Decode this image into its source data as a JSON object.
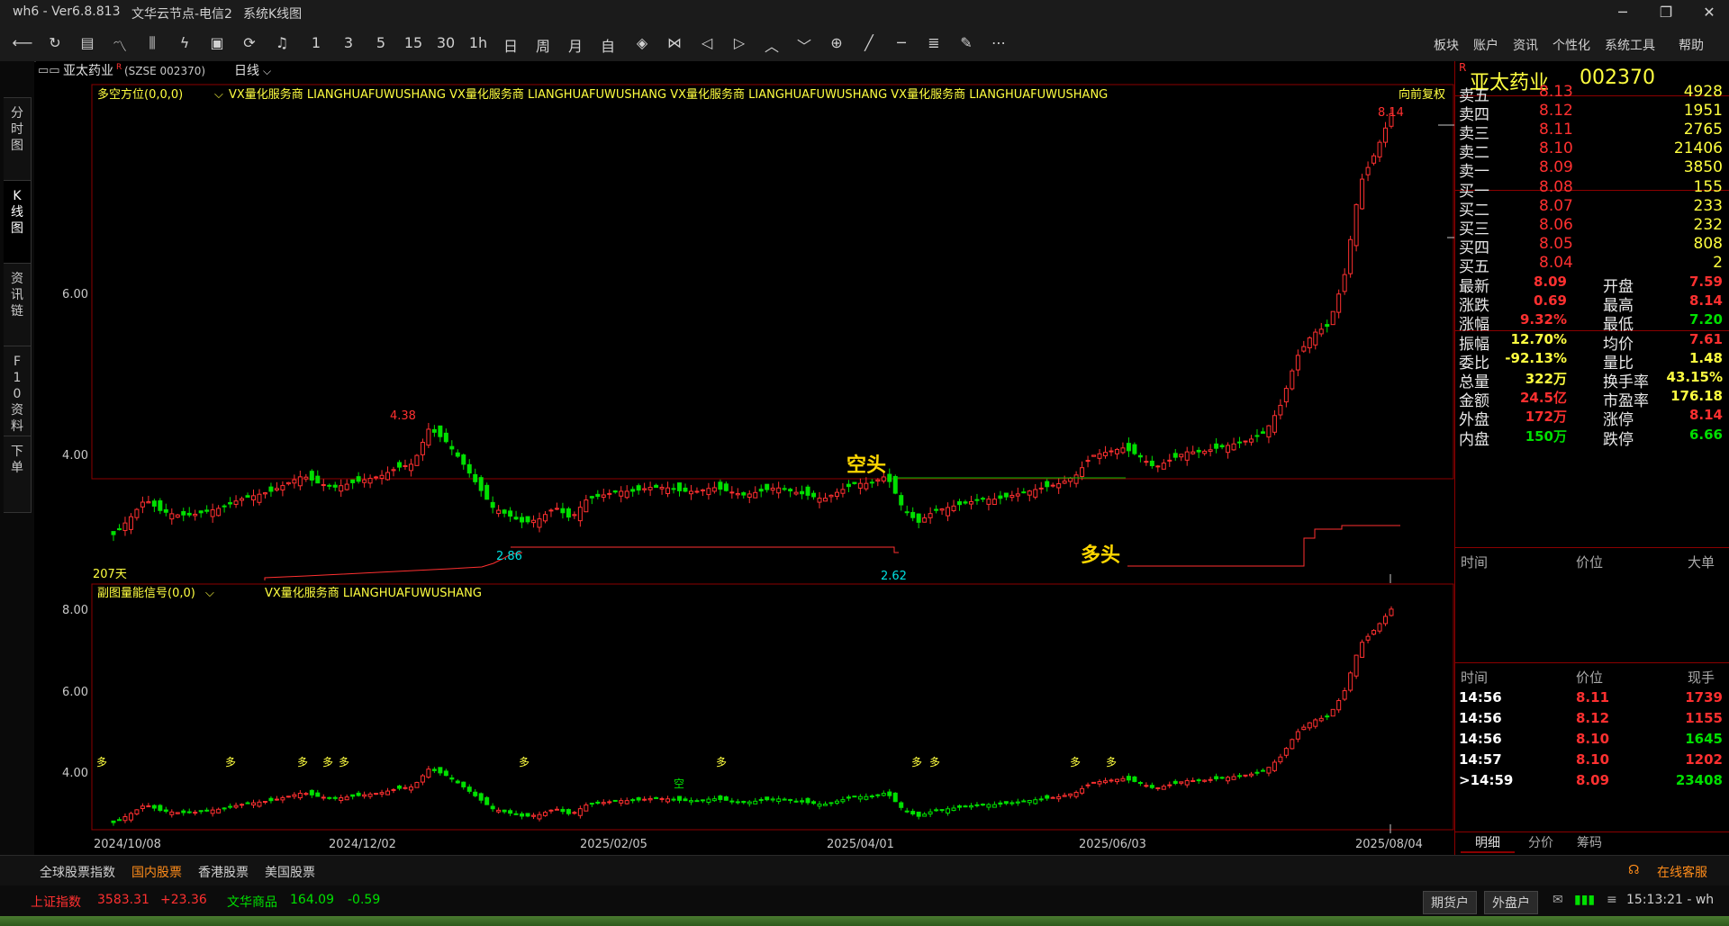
{
  "titlebar": {
    "app": "wh6  -  Ver6.8.813",
    "server": "文华云节点-电信2",
    "window": "系统K线图"
  },
  "toolbar": {
    "icons": [
      "back-icon",
      "refresh-icon",
      "table-icon",
      "line-icon",
      "candle-icon",
      "indicator-icon",
      "tick-icon",
      "sync-icon",
      "bell-icon"
    ],
    "periods": [
      "1",
      "3",
      "5",
      "15",
      "30",
      "1h",
      "日",
      "周",
      "月",
      "自"
    ],
    "menus": [
      "板块",
      "账户",
      "资讯",
      "个性化",
      "系统工具",
      "帮助"
    ]
  },
  "sidetabs": [
    "分时图",
    "K线图",
    "资讯链",
    "F10资料",
    "下单"
  ],
  "header": {
    "symbol": "亚太药业",
    "flag": "R",
    "code": "(SZSE 002370)",
    "period": "日线"
  },
  "main_panel": {
    "indicator": "多空方位(0,0,0)",
    "ads": "VX量化服务商  LIANGHUAFUWUSHANG  VX量化服务商  LIANGHUAFUWUSHANG  VX量化服务商  LIANGHUAFUWUSHANG  VX量化服务商  LIANGHUAFUWUSHANG",
    "adjust": "向前复权",
    "days": "207天",
    "annotations": {
      "high": "4.38",
      "low1": "2.86",
      "low2": "2.62",
      "last_high": "8.14",
      "bear": "空头",
      "bull": "多头"
    },
    "y_ticks": [
      "6.00",
      "4.00"
    ]
  },
  "sub_panel": {
    "indicator": "副图量能信号(0,0)",
    "ads": "VX量化服务商  LIANGHUAFUWUSHANG",
    "y_ticks": [
      "8.00",
      "6.00",
      "4.00"
    ]
  },
  "x_ticks": [
    "2024/10/08",
    "2024/12/02",
    "2025/02/05",
    "2025/04/01",
    "2025/06/03",
    "2025/08/04"
  ],
  "chart_data": {
    "type": "candlestick",
    "title": "亚太药业 002370 日线",
    "x_labels": [
      "2024/10/08",
      "2024/12/02",
      "2025/02/05",
      "2025/04/01",
      "2025/06/03",
      "2025/08/04"
    ],
    "close_path": [
      2.75,
      2.95,
      3.2,
      3.05,
      3.0,
      3.0,
      3.05,
      3.1,
      3.2,
      3.25,
      3.3,
      3.4,
      3.5,
      3.4,
      3.35,
      3.4,
      3.45,
      3.5,
      3.6,
      3.65,
      4.1,
      3.95,
      3.7,
      3.4,
      3.1,
      3.0,
      2.9,
      2.95,
      3.1,
      2.95,
      3.2,
      3.25,
      3.3,
      3.3,
      3.35,
      3.35,
      3.3,
      3.3,
      3.35,
      3.3,
      3.25,
      3.3,
      3.35,
      3.3,
      3.25,
      3.2,
      3.3,
      3.4,
      3.4,
      3.5,
      3.1,
      2.9,
      3.05,
      3.1,
      3.15,
      3.2,
      3.2,
      3.25,
      3.3,
      3.35,
      3.4,
      3.5,
      3.75,
      3.8,
      3.85,
      3.75,
      3.6,
      3.7,
      3.8,
      3.8,
      3.85,
      3.9,
      3.95,
      4.05,
      4.4,
      5.0,
      5.3,
      5.4,
      6.0,
      7.2,
      7.6,
      8.09
    ],
    "price_range": [
      2.5,
      8.3
    ],
    "annotations": {
      "high_4_38": 4.38,
      "low_2_86": 2.86,
      "low_2_62": 2.62,
      "high_8_14": 8.14
    }
  },
  "quote": {
    "name": "亚太药业",
    "code": "002370",
    "flag": "R",
    "asks": [
      {
        "label": "卖五",
        "price": "8.13",
        "vol": "4928"
      },
      {
        "label": "卖四",
        "price": "8.12",
        "vol": "1951"
      },
      {
        "label": "卖三",
        "price": "8.11",
        "vol": "2765"
      },
      {
        "label": "卖二",
        "price": "8.10",
        "vol": "21406"
      },
      {
        "label": "卖一",
        "price": "8.09",
        "vol": "3850"
      }
    ],
    "bids": [
      {
        "label": "买一",
        "price": "8.08",
        "vol": "155"
      },
      {
        "label": "买二",
        "price": "8.07",
        "vol": "233"
      },
      {
        "label": "买三",
        "price": "8.06",
        "vol": "232"
      },
      {
        "label": "买四",
        "price": "8.05",
        "vol": "808"
      },
      {
        "label": "买五",
        "price": "8.04",
        "vol": "2"
      }
    ],
    "stats": [
      {
        "l1": "最新",
        "v1": "8.09",
        "c1": "red",
        "l2": "开盘",
        "v2": "7.59",
        "c2": "red"
      },
      {
        "l1": "涨跌",
        "v1": "0.69",
        "c1": "red",
        "l2": "最高",
        "v2": "8.14",
        "c2": "red"
      },
      {
        "l1": "涨幅",
        "v1": "9.32%",
        "c1": "red",
        "l2": "最低",
        "v2": "7.20",
        "c2": "grn"
      },
      {
        "l1": "振幅",
        "v1": "12.70%",
        "c1": "yel",
        "l2": "均价",
        "v2": "7.61",
        "c2": "red"
      },
      {
        "l1": "委比",
        "v1": "-92.13%",
        "c1": "yel",
        "l2": "量比",
        "v2": "1.48",
        "c2": "yel"
      },
      {
        "l1": "总量",
        "v1": "322万",
        "c1": "yel",
        "l2": "换手率",
        "v2": "43.15%",
        "c2": "yel"
      },
      {
        "l1": "金额",
        "v1": "24.5亿",
        "c1": "red",
        "l2": "市盈率",
        "v2": "176.18",
        "c2": "yel"
      },
      {
        "l1": "外盘",
        "v1": "172万",
        "c1": "red",
        "l2": "涨停",
        "v2": "8.14",
        "c2": "red"
      },
      {
        "l1": "内盘",
        "v1": "150万",
        "c1": "grn",
        "l2": "跌停",
        "v2": "6.66",
        "c2": "grn"
      }
    ],
    "bigorder_headers": [
      "时间",
      "价位",
      "大单"
    ],
    "trade_headers": [
      "时间",
      "价位",
      "现手"
    ],
    "trades": [
      {
        "t": "14:56",
        "p": "8.11",
        "v": "1739",
        "c": "red"
      },
      {
        "t": "14:56",
        "p": "8.12",
        "v": "1155",
        "c": "red"
      },
      {
        "t": "14:56",
        "p": "8.10",
        "v": "1645",
        "c": "grn"
      },
      {
        "t": "14:57",
        "p": "8.10",
        "v": "1202",
        "c": "red"
      },
      {
        "t": ">14:59",
        "p": "8.09",
        "v": "23408",
        "c": "grn"
      }
    ],
    "tabs": [
      "明细",
      "分价",
      "筹码"
    ]
  },
  "market_tabs": [
    "全球股票指数",
    "国内股票",
    "香港股票",
    "美国股票"
  ],
  "service": "在线客服",
  "ticker": {
    "idx_name": "上证指数",
    "idx_val": "3583.31",
    "idx_chg": "+23.36",
    "com_name": "文华商品",
    "com_val": "164.09",
    "com_chg": "-0.59"
  },
  "status": {
    "btn1": "期货户",
    "btn2": "外盘户",
    "time": "15:13:21 - wh"
  },
  "colors": {
    "up": "#ff3030",
    "down": "#00e000",
    "frame": "#8b0000",
    "accent": "#ffff40"
  }
}
